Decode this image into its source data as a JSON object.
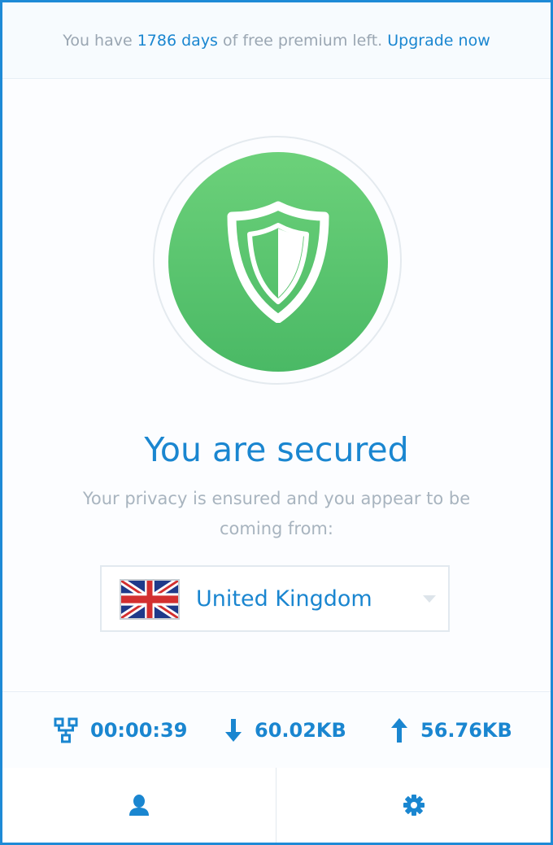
{
  "banner": {
    "text_before": "You have ",
    "days": "1786 days",
    "text_after": " of free premium left. ",
    "upgrade_link": "Upgrade now"
  },
  "status": {
    "title": "You are secured",
    "subtitle": "Your privacy is ensured and you appear to be coming from:",
    "shield_icon": "shield-icon",
    "accent_color": "#1a86d0",
    "secured_color": "#4ab965"
  },
  "location": {
    "country": "United Kingdom",
    "flag_icon": "uk-flag-icon"
  },
  "stats": {
    "duration": "00:00:39",
    "download": "60.02KB",
    "upload": "56.76KB"
  },
  "footer": {
    "account_icon": "user-icon",
    "settings_icon": "gear-icon"
  }
}
